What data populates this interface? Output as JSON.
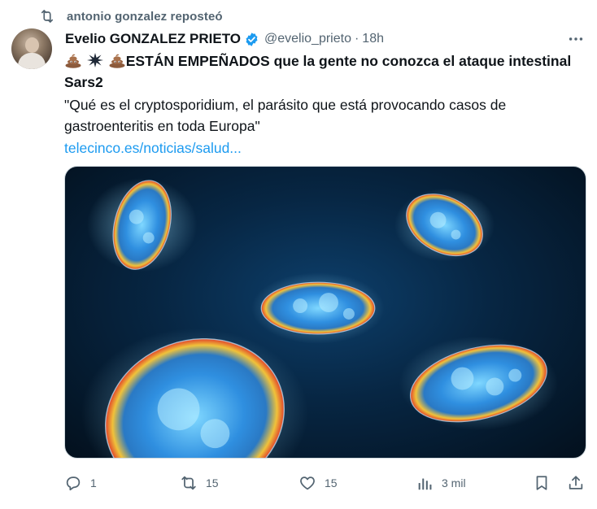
{
  "repost": {
    "text": "antonio gonzalez reposteó"
  },
  "author": {
    "name": "Evelio GONZALEZ PRIETO",
    "handle": "@evelio_prieto",
    "separator": "·",
    "time": "18h"
  },
  "post": {
    "headline": "ESTÁN EMPEÑADOS que la gente no conozca el ataque intestinal Sars2",
    "quote": "\"Qué es el cryptosporidium, el parásito que está provocando casos de gastroenteritis en toda Europa\"",
    "link": "telecinco.es/noticias/salud..."
  },
  "actions": {
    "replies": "1",
    "reposts": "15",
    "likes": "15",
    "views": "3 mil"
  },
  "colors": {
    "link": "#1d9bf0",
    "verified": "#1d9bf0",
    "muted": "#536471"
  },
  "icons": [
    "repost-icon",
    "verified-icon",
    "more-icon",
    "poop-emoji",
    "explosion-emoji",
    "reply-icon",
    "like-icon",
    "views-icon",
    "bookmark-icon",
    "share-icon"
  ]
}
